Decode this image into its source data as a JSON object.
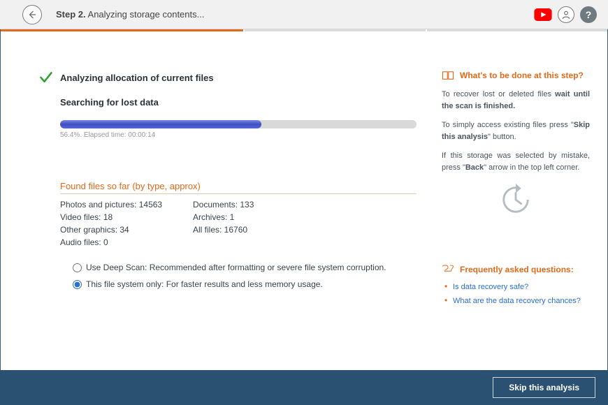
{
  "header": {
    "step_label": "Step 2.",
    "title": "Analyzing storage contents..."
  },
  "main": {
    "analyzing_title": "Analyzing allocation of current files",
    "searching_title": "Searching for lost data",
    "progress_percent": 56.4,
    "progress_status": "56.4%. Elapsed time: 00:00:14",
    "found_head": "Found files so far (by type, approx)",
    "found": {
      "photos": "Photos and pictures: 14563",
      "video": "Video files: 18",
      "othergfx": "Other graphics: 34",
      "audio": "Audio files: 0",
      "documents": "Documents: 133",
      "archives": "Archives: 1",
      "allfiles": "All files: 16760"
    },
    "opt_deep": "Use Deep Scan: Recommended after formatting or severe file system corruption.",
    "opt_thisfs": "This file system only: For faster results and less memory usage."
  },
  "side": {
    "whats_head": "What's to be done at this step?",
    "p1a": "To recover lost or deleted files ",
    "p1b": "wait until the scan is finished.",
    "p2a": "To simply access existing files press \"",
    "p2b": "Skip this analysis",
    "p2c": "\" button.",
    "p3a": "If this storage was selected by mistake, press \"",
    "p3b": "Back",
    "p3c": "\" arrow in the top left corner.",
    "faq_head": "Frequently asked questions:",
    "faq": [
      "Is data recovery safe?",
      "What are the data recovery chances?"
    ]
  },
  "footer": {
    "skip_label": "Skip this analysis"
  },
  "colors": {
    "accent": "#e36a1a",
    "footer_bg": "#2a5172",
    "progress_fill": "#5866d5"
  }
}
